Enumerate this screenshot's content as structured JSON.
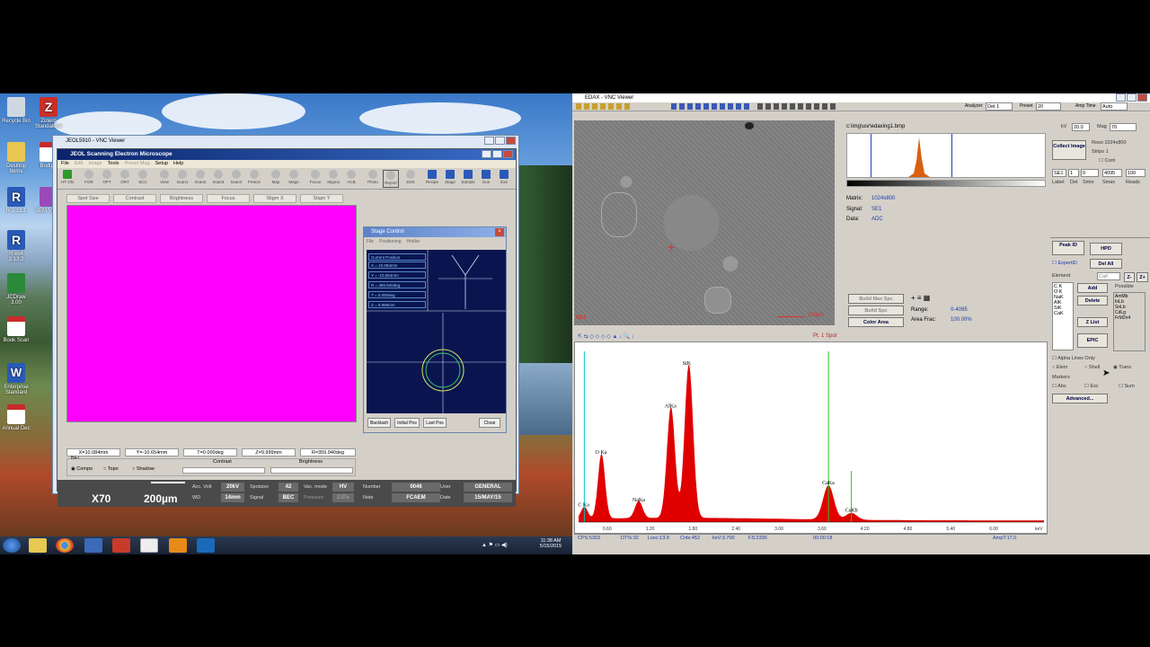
{
  "desktop": {
    "icons": [
      {
        "label": "Recycle Bin"
      },
      {
        "label": "Zotero Standalone"
      },
      {
        "label": "Desktop Items"
      },
      {
        "label": "Budget"
      },
      {
        "label": "R 2.13.1"
      },
      {
        "label": "SEM Video"
      },
      {
        "label": "R x64 2.13.2"
      },
      {
        "label": "JCDraw 3.00"
      },
      {
        "label": "Book Scan"
      },
      {
        "label": "Enterprise Standard"
      },
      {
        "label": "Annual Dec"
      }
    ],
    "taskbar": {
      "time": "11:38 AM",
      "date": "5/15/2015"
    }
  },
  "jeol": {
    "vnc_title": "JEOL5910 - VNC Viewer",
    "app_title": "JEOL Scanning Electron Microscope",
    "menu": [
      "File",
      "Edit",
      "Image",
      "Tools",
      "Preset Mag",
      "Setup",
      "Help"
    ],
    "tools": [
      "HT ON",
      "FOR",
      "OPT",
      "ORT",
      "SCC",
      "View",
      "Scan1",
      "Scan2",
      "Scan3",
      "Scan4",
      "Freeze",
      "Map",
      "Magn",
      "Focus",
      "Stigma",
      "ACB",
      "Photo",
      "Report",
      "EDS",
      "Recipe",
      "Stage",
      "Sample",
      "Gun",
      "Exit"
    ],
    "tabs": [
      "Spot Size",
      "Contrast",
      "Brightness",
      "Focus",
      "Stigm X",
      "Stigm Y"
    ],
    "readouts": [
      "X=10.084mm",
      "Y=-10.654mm",
      "T=0.000deg",
      "Z=9.999mm",
      "R=359.940deg"
    ],
    "bei": {
      "label": "BEI",
      "options": [
        "Compo",
        "Topo",
        "Shadow"
      ],
      "contrast": "Contrast",
      "brightness": "Brightness"
    },
    "bottom": {
      "mag": "X70",
      "scale": "200µm",
      "acc_volt_label": "Acc. Volt",
      "acc_volt": "20kV",
      "wd_label": "WD",
      "wd": "14mm",
      "spotsize_label": "Spotsize",
      "spotsize": "42",
      "signal_label": "Signal",
      "signal": "BEC",
      "vac_label": "Vac. mode",
      "vac": "HV",
      "pressure_label": "Pressure",
      "pressure": "21Pa",
      "number_label": "Number",
      "number": "0046",
      "note_label": "Note",
      "note": "FCAEM",
      "user_label": "User",
      "user": "GENERAL",
      "date_label": "Date",
      "date": "15/MAY/15"
    },
    "stage": {
      "title": "Stage Control",
      "menu": [
        "File",
        "Positioning",
        "Holder"
      ],
      "current_position": "Current Position",
      "positions": [
        "X = 10.084mm",
        "Y = -10.654mm",
        "R = 359.940deg",
        "T = 0.000deg",
        "Z = 9.999mm"
      ],
      "buttons": [
        "Backlash",
        "Initial Pos",
        "Last Pos",
        "Close"
      ]
    }
  },
  "edax": {
    "title": "EDAX - VNC Viewer",
    "analyzer_label": "Analyzer",
    "analyzer": "Det 1",
    "preset_label": "Preset",
    "preset": "20",
    "amp_time_label": "Amp Time",
    "amp_time": "Auto",
    "image": {
      "label": "SE1",
      "scalebar": "200µm"
    },
    "image_file": "c:\\img\\usr\\edaxing1.bmp",
    "matrix_label": "Matrix:",
    "matrix": "1024x800",
    "signal_label": "Signal:",
    "signal": "SE1",
    "data_label": "Data:",
    "data": "ADC",
    "buttons": {
      "build_max": "Build Max Spc",
      "build_spc": "Build Spc",
      "color_area": "Color Area"
    },
    "range_label": "Range:",
    "range": "0-4095",
    "area_frac_label": "Area Frac:",
    "area_frac": "100.00%",
    "spectrum_header": "Pt. 1 Spot",
    "status": {
      "cps": "CPS:5303",
      "dt": "DT%:32",
      "lsec": "Lsec:13.9",
      "cnts": "Cnts:452",
      "kev": "keV:3.700",
      "fs": "FS:2336",
      "time": "00:00:18",
      "amp": "AmpT:17.0"
    },
    "right": {
      "kv_label": "kV",
      "kv": "20.0",
      "mag_label": "Mag",
      "mag": "70",
      "collect_image": "Collect Image",
      "reso": "Reso 1024x800",
      "strips": "Strips 1",
      "cont": "Cont",
      "row_vals": [
        "SE1",
        "1",
        "0",
        "4095",
        "100"
      ],
      "row_labels": [
        "Label",
        "Det",
        "Smin",
        "Smax",
        "Reads"
      ],
      "peak_id": "Peak ID",
      "hpd": "HPD",
      "del_all": "Del All",
      "expert_id": "ExpertID",
      "element_label": "Element",
      "element": "CaK",
      "z_minus": "Z-",
      "z_plus": "Z+",
      "possible": "Possible",
      "elements": [
        "C K",
        "O K",
        "NaK",
        "AlK",
        "SiK",
        "CaK"
      ],
      "possible_list": [
        "AmMb",
        "InLb",
        "SnLb",
        "CdLg",
        "FrM2n4"
      ],
      "add": "Add",
      "delete": "Delete",
      "z_list": "Z List",
      "epic": "EPIC",
      "alpha_lines": "Alpha Lines Only",
      "elem": "Elem",
      "shell": "Shell",
      "trans": "Trans",
      "markers": "Markers",
      "abs": "Abs",
      "esc": "Esc",
      "sum": "Sum",
      "advanced": "Advanced..."
    }
  },
  "chart_data": {
    "type": "line",
    "xlabel": "keV",
    "x_ticks": [
      0.6,
      1.2,
      1.8,
      2.4,
      3.0,
      3.6,
      4.2,
      4.8,
      5.4,
      6.0
    ],
    "xlim": [
      0.2,
      6.7
    ],
    "peaks": [
      {
        "label": "C Ka",
        "kev": 0.28,
        "height": 0.07
      },
      {
        "label": "O Ka",
        "kev": 0.52,
        "height": 0.38
      },
      {
        "label": "NaKa",
        "kev": 1.04,
        "height": 0.1
      },
      {
        "label": "AlKa",
        "kev": 1.49,
        "height": 0.65
      },
      {
        "label": "SiK",
        "kev": 1.74,
        "height": 0.9
      },
      {
        "label": "CaKa",
        "kev": 3.69,
        "height": 0.2
      },
      {
        "label": "CaKb",
        "kev": 4.01,
        "height": 0.04
      }
    ],
    "colors": {
      "fill": "#e00000",
      "marker_cyan": "#00c8c8",
      "marker_green": "#20c820"
    }
  }
}
